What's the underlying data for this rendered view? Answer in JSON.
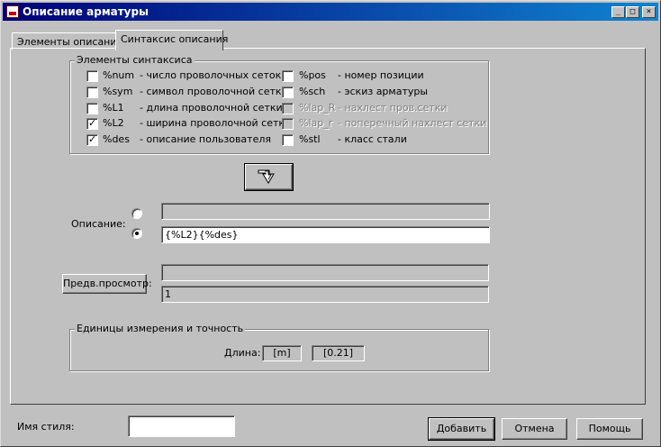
{
  "window": {
    "title": "Описание арматуры"
  },
  "title_buttons": {
    "minimize": "_",
    "maximize": "□",
    "close": "×"
  },
  "tabs": [
    {
      "label": "Элементы описания",
      "active": false
    },
    {
      "label": "Синтаксис описания",
      "active": true
    }
  ],
  "syntax": {
    "group_title": "Элементы синтаксиса",
    "left": [
      {
        "code": "%num",
        "desc": "- число проволочных сеток",
        "checked": false,
        "enabled": true
      },
      {
        "code": "%sym",
        "desc": "- символ проволочной сетки",
        "checked": false,
        "enabled": true
      },
      {
        "code": "%L1",
        "desc": "- длина проволочной сетки",
        "checked": false,
        "enabled": true
      },
      {
        "code": "%L2",
        "desc": "- ширина проволочной сетки",
        "checked": true,
        "enabled": true
      },
      {
        "code": "%des",
        "desc": "- описание пользователя",
        "checked": true,
        "enabled": true
      }
    ],
    "right": [
      {
        "code": "%pos",
        "desc": "- номер позиции",
        "checked": false,
        "enabled": true
      },
      {
        "code": "%sch",
        "desc": "- эскиз арматуры",
        "checked": false,
        "enabled": true
      },
      {
        "code": "%lap_R",
        "desc": "- нахлест пров.сетки",
        "checked": false,
        "enabled": false
      },
      {
        "code": "%lap_r",
        "desc": "- поперечный нахлест сетки",
        "checked": false,
        "enabled": false
      },
      {
        "code": "%stl",
        "desc": "- класс стали",
        "checked": false,
        "enabled": true
      }
    ],
    "insert_icon": "arrow-down-insert-icon"
  },
  "description": {
    "label": "Описание:",
    "field1_value": "",
    "field2_value": "{%L2}{%des}",
    "selected_radio": 2
  },
  "preview": {
    "button_label": "Предв.просмотр:",
    "line1": "",
    "line2": "1"
  },
  "units": {
    "group_title": "Единицы измерения и точность",
    "length_label": "Длина:",
    "unit_value": "[m]",
    "precision_value": "[0.21]"
  },
  "footer": {
    "style_label": "Имя стиля:",
    "style_value": "",
    "add_label": "Добавить",
    "cancel_label": "Отмена",
    "help_label": "Помощь"
  }
}
